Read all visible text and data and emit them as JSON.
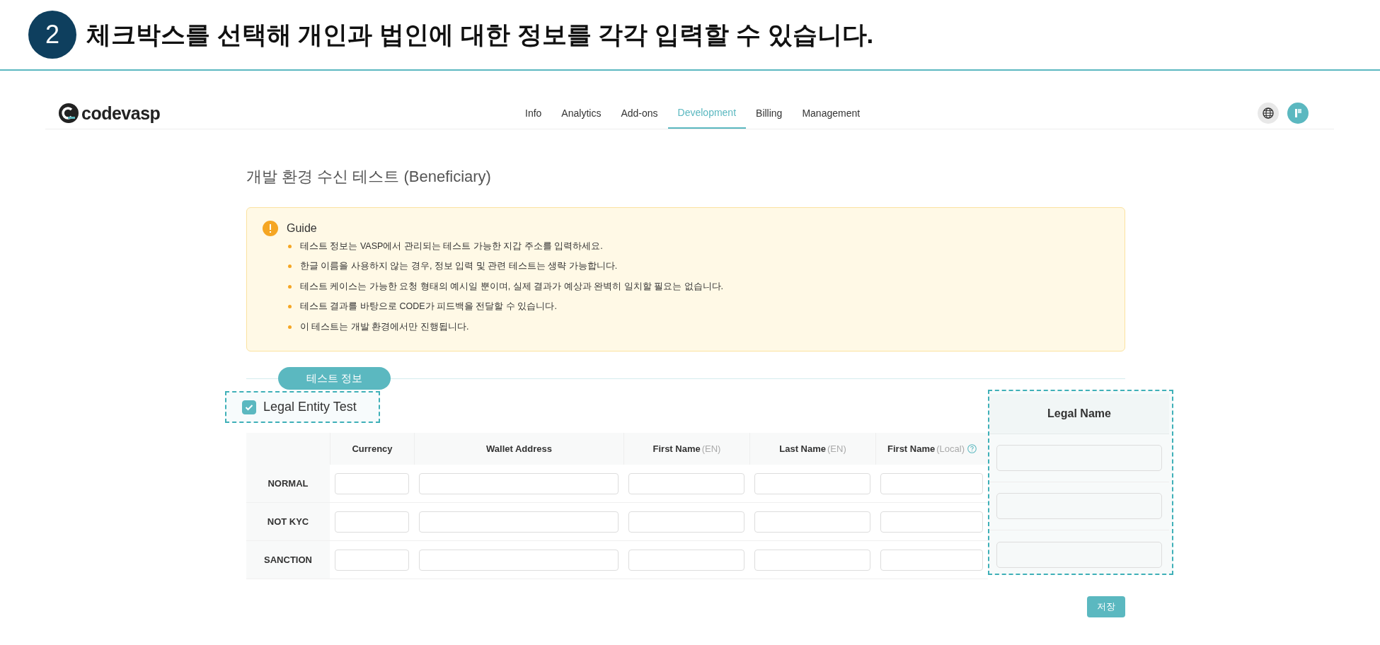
{
  "banner": {
    "step": "2",
    "title": "체크박스를 선택해 개인과 법인에 대한 정보를 각각 입력할 수 있습니다."
  },
  "nav": {
    "logo": "codevasp",
    "items": [
      {
        "label": "Info",
        "selected": false
      },
      {
        "label": "Analytics",
        "selected": false
      },
      {
        "label": "Add-ons",
        "selected": false
      },
      {
        "label": "Development",
        "selected": true
      },
      {
        "label": "Billing",
        "selected": false
      },
      {
        "label": "Management",
        "selected": false
      }
    ]
  },
  "page_title": "개발 환경 수신 테스트 (Beneficiary)",
  "guide": {
    "title": "Guide",
    "items": [
      "테스트 정보는 VASP에서 관리되는 테스트 가능한 지갑 주소를 입력하세요.",
      "한글 이름을 사용하지 않는 경우, 정보 입력 및 관련 테스트는 생략 가능합니다.",
      "테스트 케이스는 가능한 요청 형태의 예시일 뿐이며, 실제 결과가 예상과 완벽히 일치할 필요는 없습니다.",
      "테스트 결과를 바탕으로 CODE가 피드백을 전달할 수 있습니다.",
      "이 테스트는 개발 환경에서만 진행됩니다."
    ]
  },
  "section_label": "테스트 정보",
  "legal_entity": {
    "label": "Legal Entity Test",
    "checked": true
  },
  "table": {
    "columns": [
      {
        "label": "Currency",
        "help": false
      },
      {
        "label": "Wallet Address",
        "help": false
      },
      {
        "label": "First Name",
        "suffix": "(EN)",
        "help": false
      },
      {
        "label": "Last Name",
        "suffix": "(EN)",
        "help": false
      },
      {
        "label": "First Name",
        "suffix": "(Local)",
        "help": true
      }
    ],
    "rows": [
      "NORMAL",
      "NOT KYC",
      "SANCTION"
    ]
  },
  "legal_name": {
    "heading": "Legal Name"
  },
  "save_button": "저장"
}
